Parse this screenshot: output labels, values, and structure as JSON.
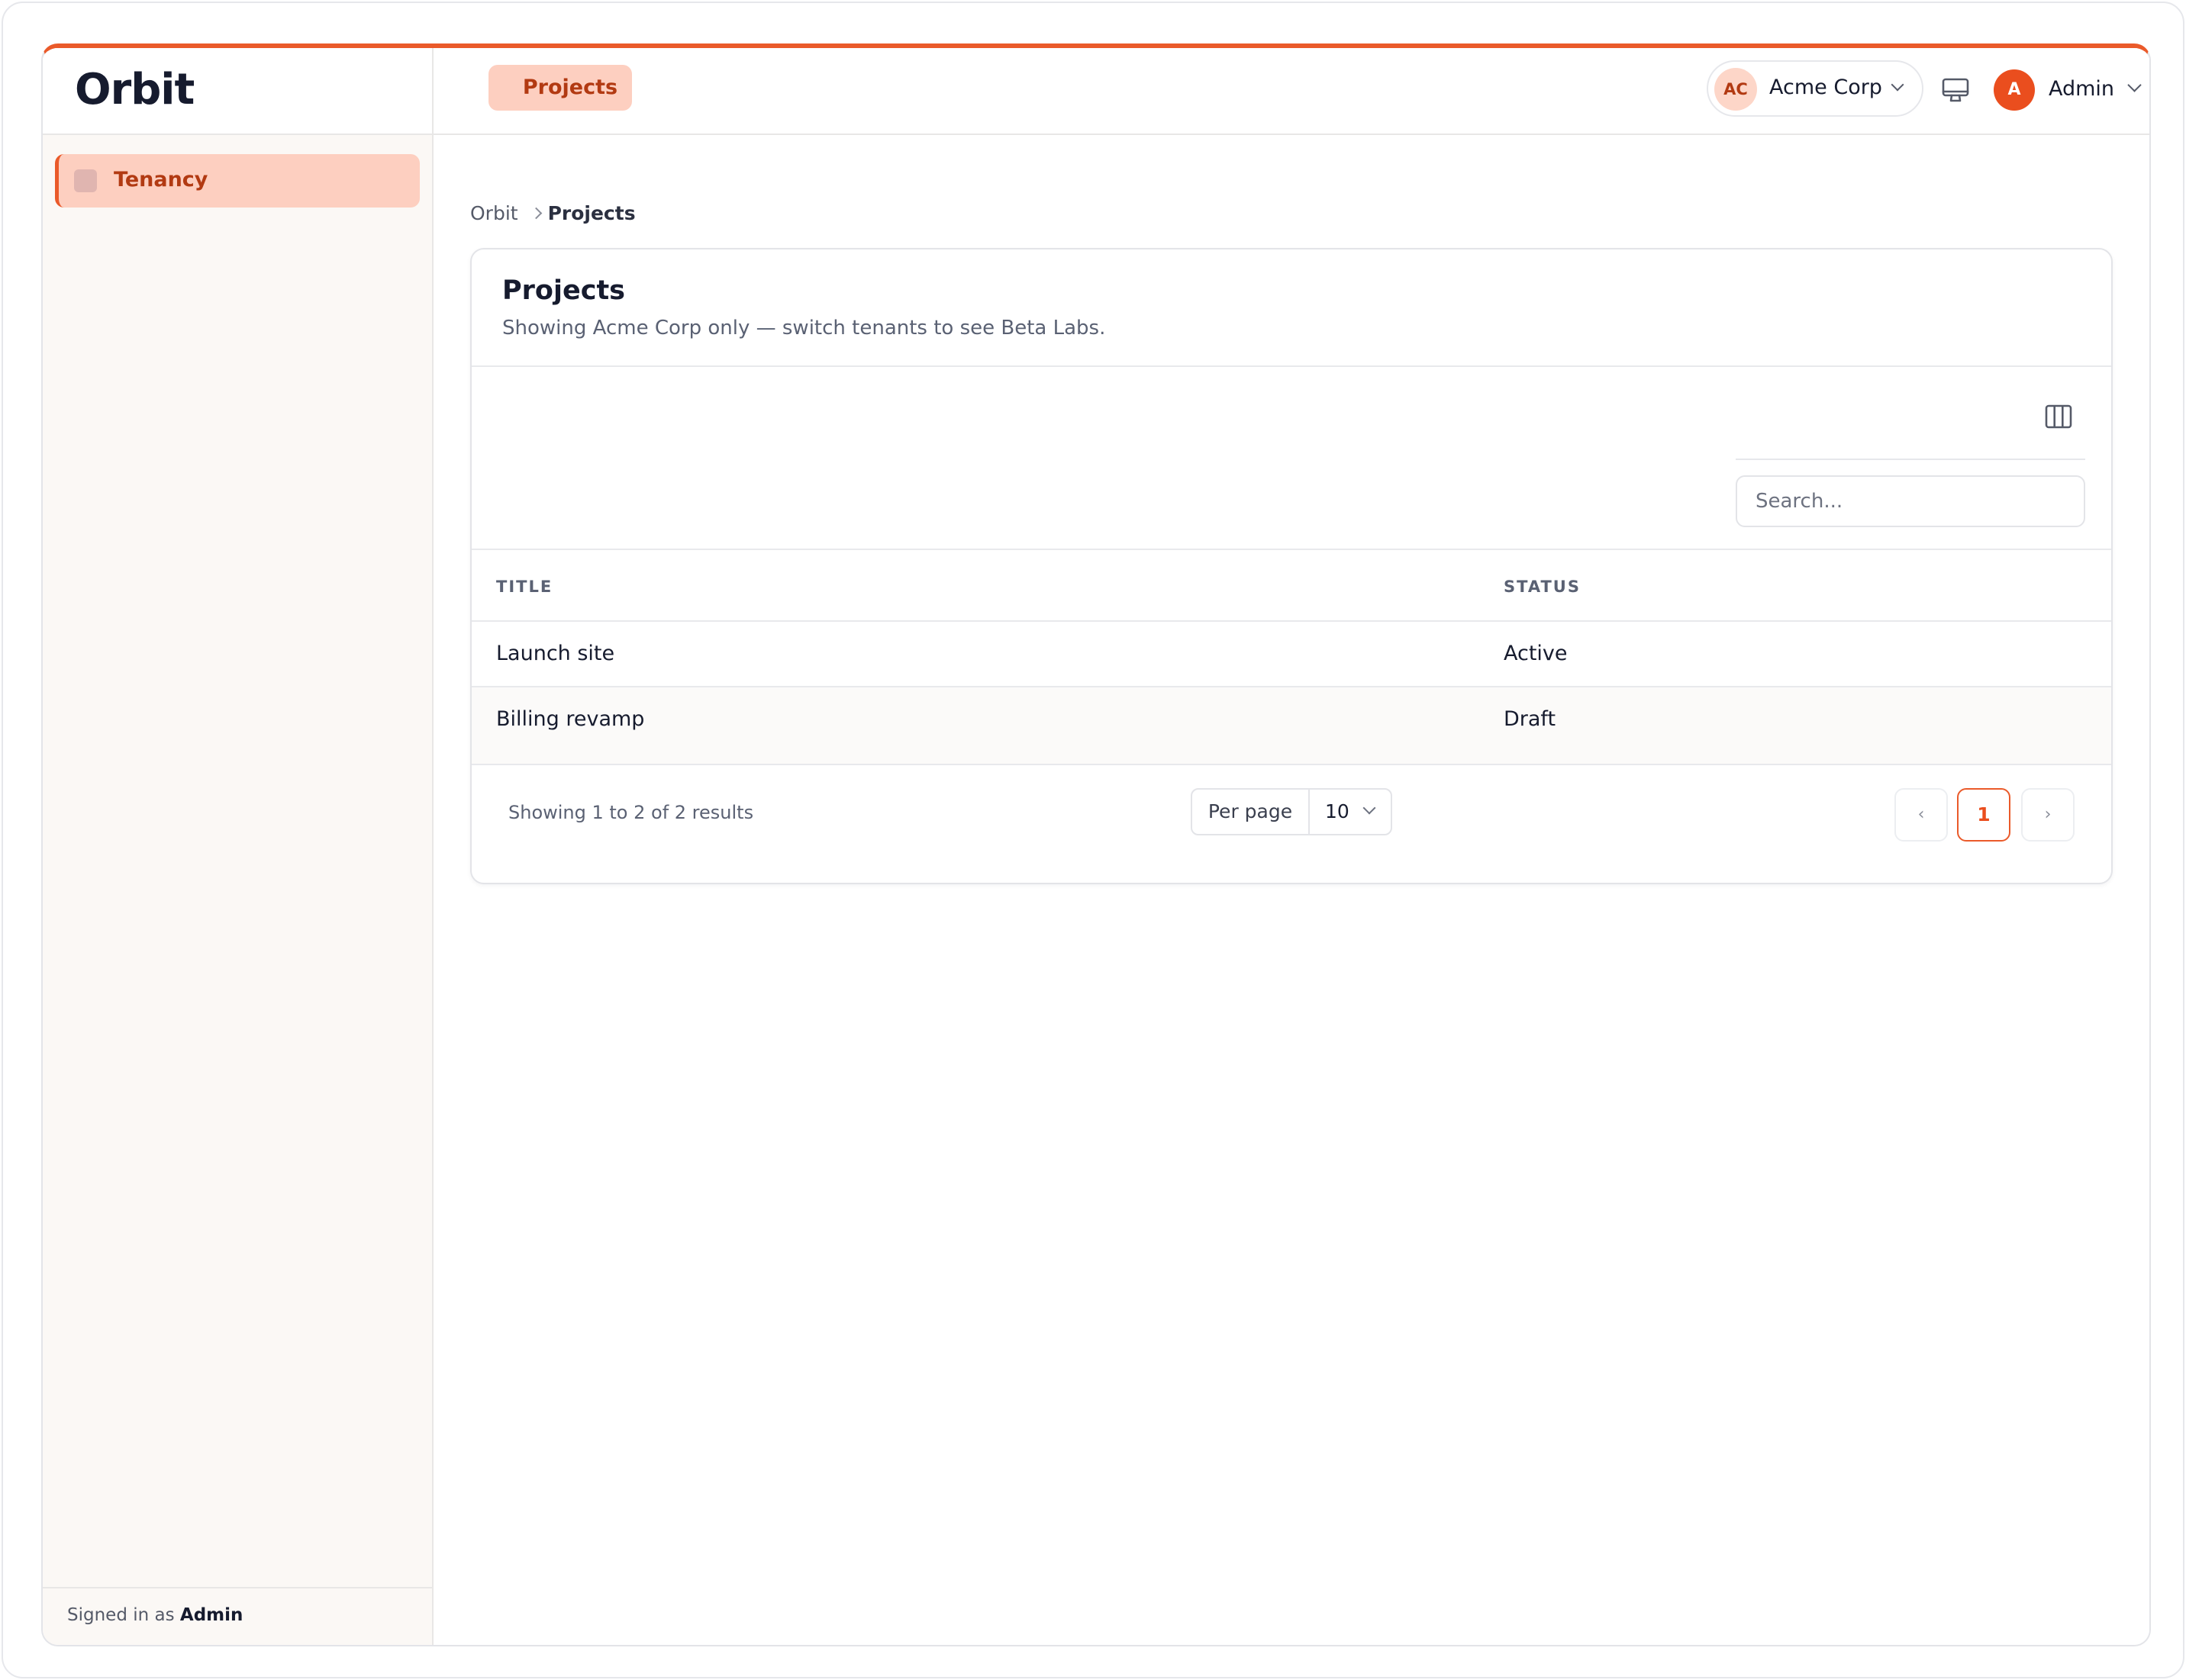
{
  "brand": {
    "name": "Orbit"
  },
  "sidebar": {
    "items": [
      {
        "label": "Tenancy",
        "icon": "square-icon"
      }
    ],
    "footer": {
      "prefix": "Signed in as",
      "user": "Admin"
    }
  },
  "topbar": {
    "tab_label": "Projects",
    "tenant": {
      "initials": "AC",
      "name": "Acme Corp"
    },
    "user": {
      "initial": "A",
      "name": "Admin"
    }
  },
  "breadcrumb": {
    "root": "Orbit",
    "current": "Projects"
  },
  "card": {
    "title": "Projects",
    "subtitle": "Showing Acme Corp only — switch tenants to see Beta Labs."
  },
  "search": {
    "placeholder": "Search..."
  },
  "table": {
    "columns": [
      "TITLE",
      "STATUS"
    ],
    "rows": [
      {
        "title": "Launch site",
        "status": "Active"
      },
      {
        "title": "Billing revamp",
        "status": "Draft"
      }
    ]
  },
  "pagination": {
    "results_text": "Showing 1 to 2 of 2 results",
    "per_page_label": "Per page",
    "per_page_value": "10",
    "prev": "‹",
    "current_page": "1",
    "next": "›"
  },
  "colors": {
    "accent": "#ea5a2a",
    "accent_soft": "#fdcfc0",
    "accent_text": "#b23a12",
    "sidebar_bg": "#fbf8f5"
  }
}
